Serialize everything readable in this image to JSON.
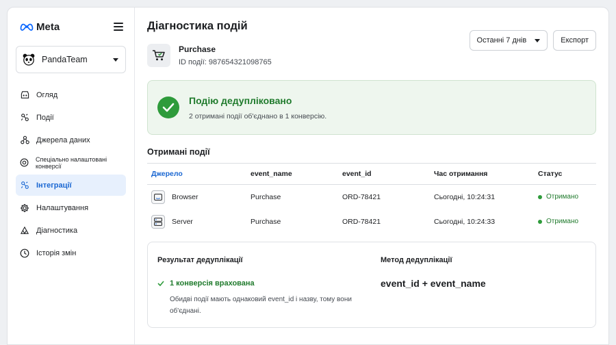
{
  "brand": {
    "logo_text": "Meta"
  },
  "account": {
    "name": "PandaTeam"
  },
  "sidebar": {
    "items": [
      {
        "label": "Огляд",
        "icon": "overview-icon"
      },
      {
        "label": "Події",
        "icon": "events-icon"
      },
      {
        "label": "Джерела даних",
        "icon": "data-sources-icon"
      },
      {
        "label": "Спеціально налаштовані конверсії",
        "icon": "custom-conversions-icon"
      },
      {
        "label": "Інтеграції",
        "icon": "integrations-icon",
        "active": true
      },
      {
        "label": "Налаштування",
        "icon": "gear-icon"
      },
      {
        "label": "Діагностика",
        "icon": "diagnostics-icon"
      },
      {
        "label": "Історія змін",
        "icon": "history-icon"
      }
    ]
  },
  "header": {
    "title": "Діагностика подій",
    "range_select": "Останні 7 днів",
    "export_label": "Експорт"
  },
  "event": {
    "name": "Purchase",
    "id_text": "ID події: 987654321098765"
  },
  "alert": {
    "title": "Подію дедупліковано",
    "subtitle": "2 отримані події об'єднано в 1 конверсію."
  },
  "received": {
    "title": "Отримані події",
    "columns": [
      "Джерело",
      "event_name",
      "event_id",
      "Час отримання",
      "Статус"
    ],
    "rows": [
      {
        "source": "Browser",
        "icon": "browser-icon",
        "event_name": "Purchase",
        "event_id": "ORD-78421",
        "time": "Сьогодні, 10:24:31",
        "status": "Отримано"
      },
      {
        "source": "Server",
        "icon": "server-icon",
        "event_name": "Purchase",
        "event_id": "ORD-78421",
        "time": "Сьогодні, 10:24:33",
        "status": "Отримано"
      }
    ]
  },
  "result": {
    "left_label": "Результат дедуплікації",
    "good_text": "1 конверсія врахована",
    "description": "Обидві події мають однаковий event_id і назву, тому вони об'єднані.",
    "right_label": "Метод дедуплікації",
    "method": "event_id + event_name"
  },
  "colors": {
    "accent": "#1a67d2",
    "success": "#2e9b3b",
    "success_text": "#1f7a2c"
  }
}
